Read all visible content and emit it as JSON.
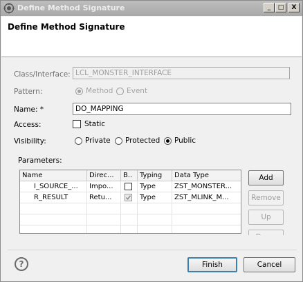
{
  "window": {
    "title": "Define Method Signature"
  },
  "header": {
    "title": "Define Method Signature"
  },
  "form": {
    "class_label": "Class/Interface:",
    "class_value": "LCL_MONSTER_INTERFACE",
    "pattern_label": "Pattern:",
    "pattern_method": "Method",
    "pattern_event": "Event",
    "name_label": "Name: *",
    "name_value": "DO_MAPPING",
    "access_label": "Access:",
    "access_static": "Static",
    "visibility_label": "Visibility:",
    "vis_private": "Private",
    "vis_protected": "Protected",
    "vis_public": "Public",
    "parameters_label": "Parameters:"
  },
  "params": {
    "columns": [
      "Name",
      "Direc...",
      "B..",
      "Typing",
      "Data Type"
    ],
    "rows": [
      {
        "name": "I_SOURCE_...",
        "direction": "Impo...",
        "by_value": false,
        "typing": "Type",
        "data_type": "ZST_MONSTER..."
      },
      {
        "name": "R_RESULT",
        "direction": "Retu...",
        "by_value": true,
        "typing": "Type",
        "data_type": "ZST_MLINK_M..."
      }
    ]
  },
  "side_buttons": {
    "add": "Add",
    "remove": "Remove",
    "up": "Up",
    "down": "Down"
  },
  "footer": {
    "help": "?",
    "finish": "Finish",
    "cancel": "Cancel"
  },
  "titlebar": {
    "min": "_",
    "max": "□",
    "close": "X"
  }
}
